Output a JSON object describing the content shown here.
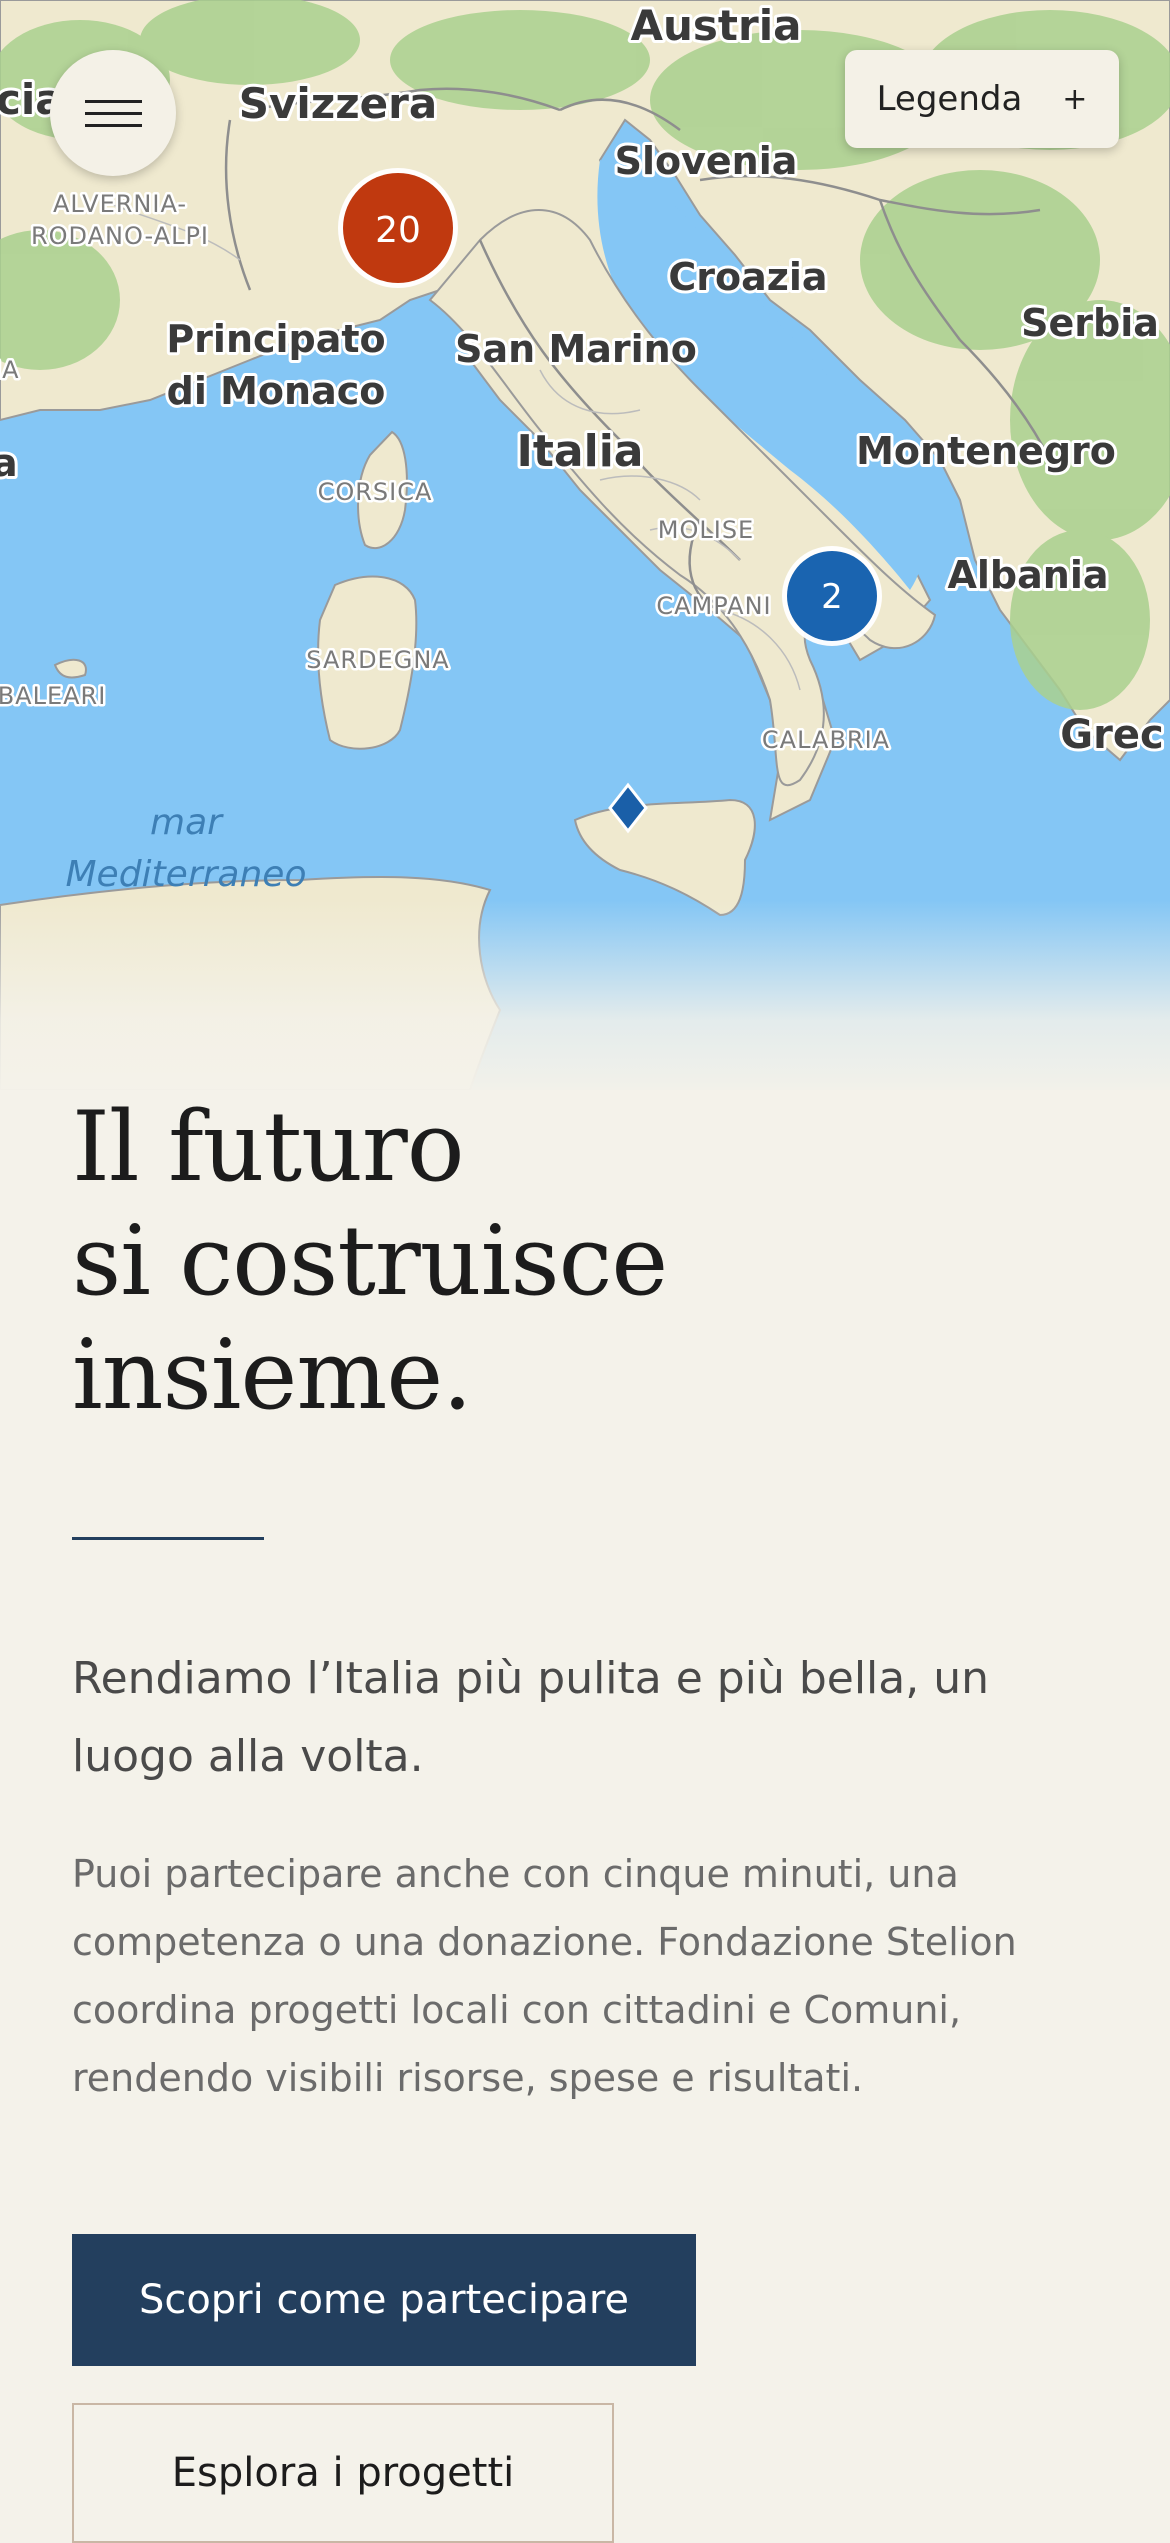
{
  "map": {
    "cluster_red_count": "20",
    "cluster_blue_count": "2",
    "colors": {
      "sea": "#84c6f5",
      "land": "#efe9cf",
      "green": "#a9d08e",
      "cluster_red": "#c0390f",
      "cluster_blue": "#1a64b0",
      "marker": "#1a5fa8"
    },
    "labels": {
      "austria": "Austria",
      "svizzera": "Svizzera",
      "slovenia": "Slovenia",
      "croazia": "Croazia",
      "serbia": "Serbia",
      "principato_1": "Principato",
      "principato_2": "di Monaco",
      "san_marino": "San Marino",
      "italia": "Italia",
      "montenegro": "Montenegro",
      "albania": "Albania",
      "grecia": "Grec",
      "edge_cia": "cia",
      "edge_ia": "IA",
      "edge_a": "a",
      "alvernia_1": "ALVERNIA-",
      "alvernia_2": "RODANO-ALPI",
      "corsica": "CORSICA",
      "molise": "MOLISE",
      "campania": "CAMPANI",
      "sardegna": "SARDEGNA",
      "baleari": "BALEARI",
      "calabria": "CALABRIA",
      "mar_1": "mar",
      "mar_2": "Mediterraneo"
    }
  },
  "header": {
    "legend_label": "Legenda",
    "legend_icon": "+"
  },
  "hero": {
    "title_line1": "Il futuro",
    "title_line2": "si costruisce",
    "title_line3": "insieme.",
    "lead": "Rendiamo l’Italia più pulita e più bella, un luogo alla volta.",
    "body": "Puoi partecipare anche con cinque minuti, una competenza o una donazione. Fondazione Stelion coordina progetti locali con cittadini e Comuni, rendendo visibili risorse, spese e risultati.",
    "cta_primary": "Scopri come partecipare",
    "cta_secondary": "Esplora i progetti"
  }
}
